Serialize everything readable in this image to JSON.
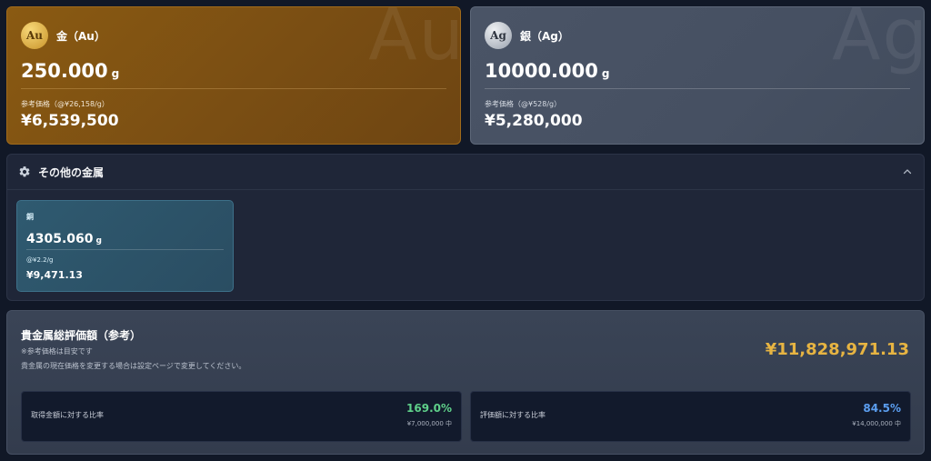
{
  "gold": {
    "symbol": "Au",
    "name": "金（Au）",
    "watermark": "Au",
    "amount": "250.000",
    "unit": "g",
    "ref_label": "参考価格（@¥26,158/g）",
    "price": "¥6,539,500"
  },
  "silver": {
    "symbol": "Ag",
    "name": "銀（Ag）",
    "watermark": "Ag",
    "amount": "10000.000",
    "unit": "g",
    "ref_label": "参考価格（@¥528/g）",
    "price": "¥5,280,000"
  },
  "others": {
    "title": "その他の金属",
    "icons": {
      "section": "gear-icon",
      "toggle": "chevron-up-icon"
    },
    "items": [
      {
        "name": "銅",
        "amount": "4305.060",
        "unit": "g",
        "rate": "@¥2.2/g",
        "price": "¥9,471.13"
      }
    ]
  },
  "total": {
    "title": "貴金属総評価額（参考）",
    "note1": "※参考価格は目安です",
    "note2": "貴金属の現在価格を変更する場合は設定ページで変更してください。",
    "amount": "¥11,828,971.13",
    "ratios": [
      {
        "label": "取得金額に対する比率",
        "value": "169.0%",
        "sub": "¥7,000,000 中"
      },
      {
        "label": "評価額に対する比率",
        "value": "84.5%",
        "sub": "¥14,000,000 中"
      }
    ]
  },
  "colors": {
    "gold_card": "#7a4e13",
    "silver_card": "#465062",
    "copper_card": "#2f5a70",
    "total_amount": "#e7b442",
    "ratio_green": "#5fd08a",
    "ratio_blue": "#5b9ef0"
  }
}
